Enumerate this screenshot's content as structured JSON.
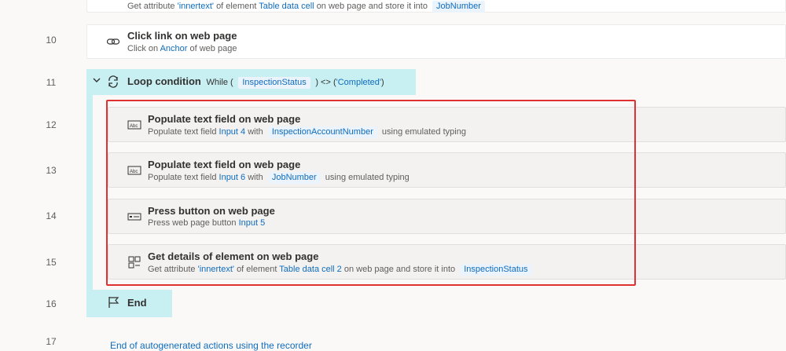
{
  "line_numbers": [
    "10",
    "11",
    "12",
    "13",
    "14",
    "15",
    "16",
    "17"
  ],
  "top_partial": {
    "prefix": "Get attribute",
    "attr": "'innertext'",
    "mid": "of element",
    "element": "Table data cell",
    "suffix": "on web page and store it into",
    "var": "JobNumber"
  },
  "steps": {
    "click_link": {
      "title": "Click link on web page",
      "desc_prefix": "Click on",
      "desc_link": "Anchor",
      "desc_suffix": "of web page",
      "icon": "link-icon"
    },
    "loop": {
      "title": "Loop condition",
      "while_prefix": "While (",
      "var": "InspectionStatus",
      "operator": ") <> (",
      "value": "'Completed'",
      "close": ")",
      "icon": "loop-icon"
    },
    "populate_1": {
      "title": "Populate text field on web page",
      "desc_prefix": "Populate text field",
      "field": "Input 4",
      "with": "with",
      "var": "InspectionAccountNumber",
      "suffix": "using emulated typing",
      "icon": "text-field-icon"
    },
    "populate_2": {
      "title": "Populate text field on web page",
      "desc_prefix": "Populate text field",
      "field": "Input 6",
      "with": "with",
      "var": "JobNumber",
      "suffix": "using emulated typing",
      "icon": "text-field-icon"
    },
    "press_button": {
      "title": "Press button on web page",
      "desc_prefix": "Press web page button",
      "button": "Input 5",
      "icon": "button-icon"
    },
    "get_details": {
      "title": "Get details of element on web page",
      "desc_prefix": "Get attribute",
      "attr": "'innertext'",
      "mid": "of element",
      "element": "Table data cell 2",
      "suffix": "on web page and store it into",
      "var": "InspectionStatus",
      "icon": "element-details-icon"
    },
    "end": {
      "title": "End",
      "icon": "flag-icon"
    }
  },
  "footer": {
    "text": "End of autogenerated actions using the recorder"
  },
  "colors": {
    "accent": "#0f6cbd",
    "loop_bg": "#c8f0f3",
    "highlight": "#e03131"
  }
}
